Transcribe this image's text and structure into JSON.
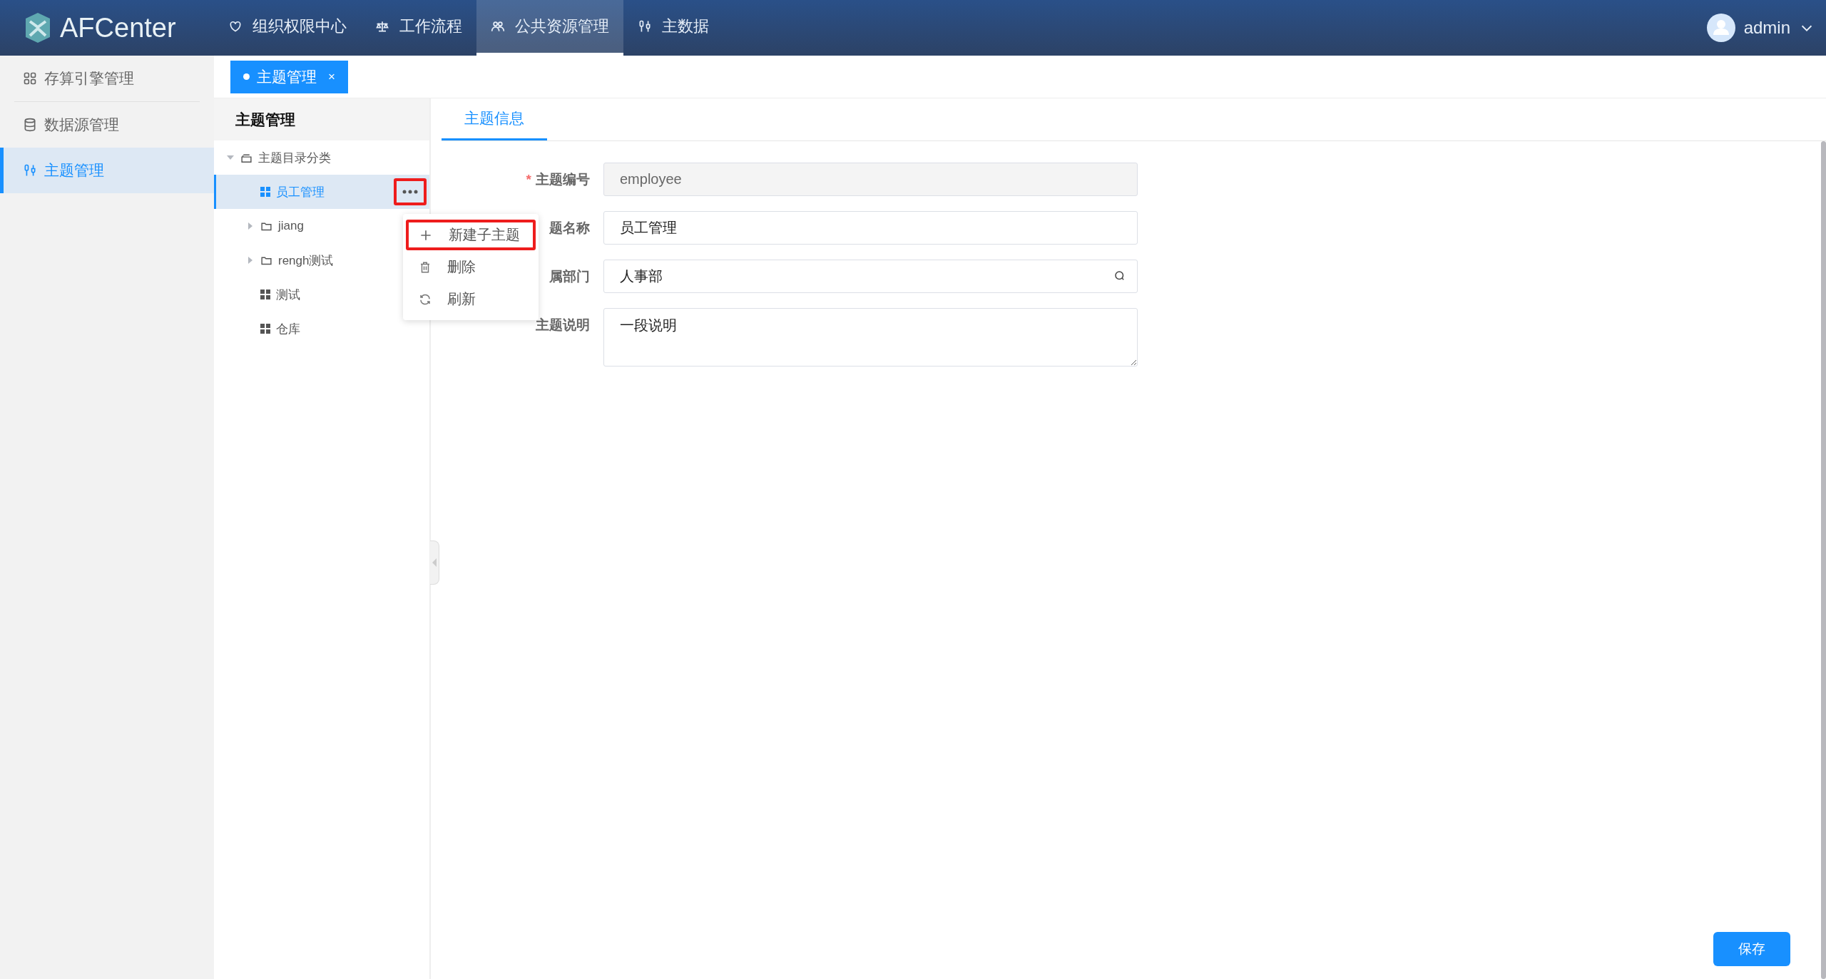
{
  "app": {
    "logo_text": "AFCenter"
  },
  "nav": [
    {
      "label": "组织权限中心",
      "selected": false
    },
    {
      "label": "工作流程",
      "selected": false
    },
    {
      "label": "公共资源管理",
      "selected": true
    },
    {
      "label": "主数据",
      "selected": false
    }
  ],
  "user": {
    "name": "admin"
  },
  "sidebar": [
    {
      "label": "存算引擎管理",
      "selected": false
    },
    {
      "label": "数据源管理",
      "selected": false
    },
    {
      "label": "主题管理",
      "selected": true
    }
  ],
  "open_tabs": [
    {
      "label": "主题管理",
      "close": "×",
      "selected": true
    }
  ],
  "tree_panel": {
    "title": "主题管理",
    "nodes": [
      {
        "label": "主题目录分类",
        "kind": "category",
        "expanded": true,
        "selected": false,
        "children": [
          {
            "label": "员工管理",
            "kind": "topic",
            "selected": true
          },
          {
            "label": "jiang",
            "kind": "folder",
            "expanded": false,
            "selected": false
          },
          {
            "label": "rengh测试",
            "kind": "folder",
            "expanded": false,
            "selected": false
          },
          {
            "label": "测试",
            "kind": "topic",
            "selected": false
          },
          {
            "label": "仓库",
            "kind": "topic",
            "selected": false
          }
        ]
      }
    ]
  },
  "context_menu": {
    "trigger_highlighted": true,
    "items": [
      {
        "label": "新建子主题",
        "kind": "add",
        "highlighted": true
      },
      {
        "label": "删除",
        "kind": "delete",
        "highlighted": false
      },
      {
        "label": "刷新",
        "kind": "refresh",
        "highlighted": false
      }
    ]
  },
  "detail": {
    "tabs": [
      {
        "label": "主题信息",
        "selected": true
      }
    ],
    "fields": [
      {
        "label": "主题编号",
        "required_mark": "*",
        "kind": "text",
        "value": "employee",
        "disabled": true
      },
      {
        "label": "题名称",
        "kind": "text",
        "value": "员工管理",
        "disabled": false
      },
      {
        "label": "属部门",
        "kind": "search",
        "value": "人事部"
      },
      {
        "label": "主题说明",
        "kind": "textarea",
        "value": "一段说明"
      }
    ]
  },
  "save_button": "保存"
}
